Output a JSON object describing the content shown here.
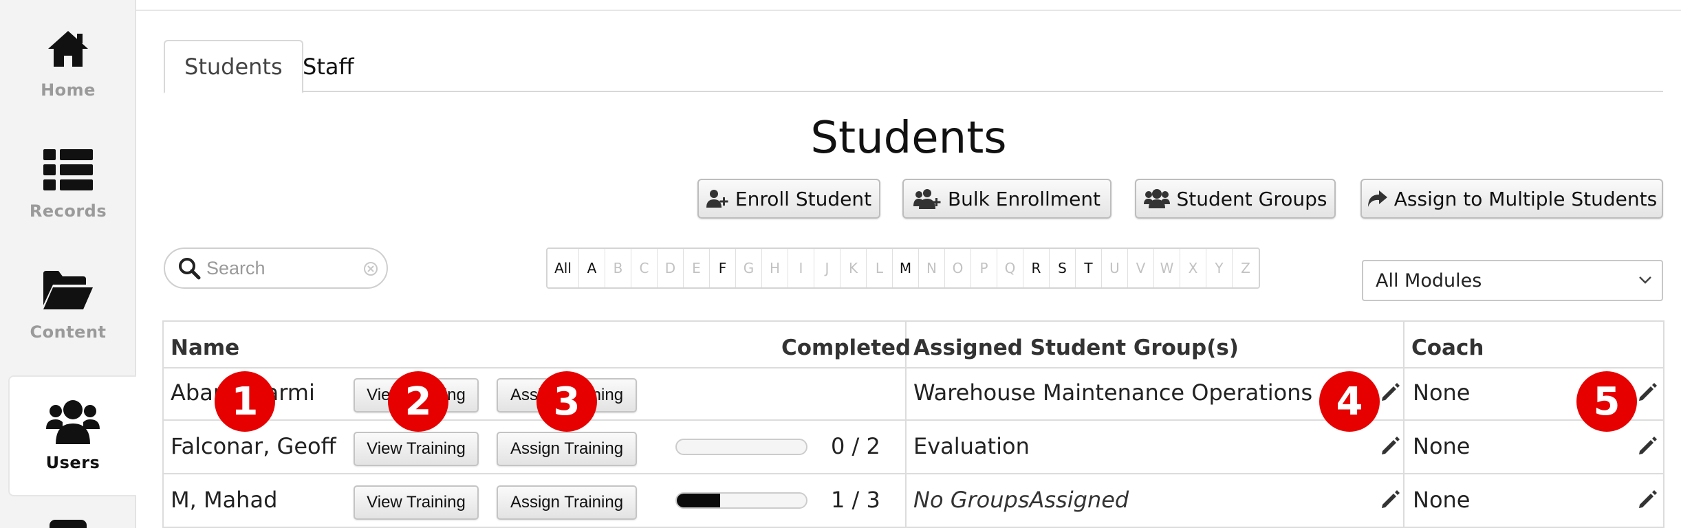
{
  "sidebar": {
    "items": [
      {
        "label": "Home",
        "icon": "home-icon"
      },
      {
        "label": "Records",
        "icon": "list-icon"
      },
      {
        "label": "Content",
        "icon": "folder-icon"
      },
      {
        "label": "Users",
        "icon": "users-icon",
        "active": true
      }
    ]
  },
  "tabs": [
    {
      "label": "Students",
      "active": true
    },
    {
      "label": "Staff",
      "active": false
    }
  ],
  "page_title": "Students",
  "actions": {
    "enroll": "Enroll Student",
    "bulk": "Bulk Enrollment",
    "groups": "Student Groups",
    "assign_multiple": "Assign to Multiple Students"
  },
  "search": {
    "placeholder": "Search",
    "value": ""
  },
  "alphabet": {
    "letters": [
      "All",
      "A",
      "B",
      "C",
      "D",
      "E",
      "F",
      "G",
      "H",
      "I",
      "J",
      "K",
      "L",
      "M",
      "N",
      "O",
      "P",
      "Q",
      "R",
      "S",
      "T",
      "U",
      "V",
      "W",
      "X",
      "Y",
      "Z"
    ],
    "enabled": [
      "All",
      "A",
      "F",
      "M",
      "R",
      "S",
      "T"
    ]
  },
  "module_filter": {
    "selected": "All Modules"
  },
  "table": {
    "headers": {
      "name": "Name",
      "completed": "Completed",
      "groups": "Assigned Student Group(s)",
      "coach": "Coach"
    },
    "rows": [
      {
        "name": "Abane, Farmi",
        "view": "View Training",
        "assign": "Assign Training",
        "progress": null,
        "count": "",
        "group": "Warehouse Maintenance Operations",
        "group_italic": false,
        "coach": "None"
      },
      {
        "name": "Falconar, Geoff",
        "view": "View Training",
        "assign": "Assign Training",
        "progress": 0.0,
        "count": "0 / 2",
        "group": "Evaluation",
        "group_italic": false,
        "coach": "None"
      },
      {
        "name": "M, Mahad",
        "view": "View Training",
        "assign": "Assign Training",
        "progress": 0.333,
        "count": "1 / 3",
        "group": "No GroupsAssigned",
        "group_italic": true,
        "coach": "None"
      }
    ]
  },
  "markers": [
    "1",
    "2",
    "3",
    "4",
    "5"
  ],
  "colors": {
    "marker": "#e60000",
    "progress_fill": "#0b0b0b"
  }
}
